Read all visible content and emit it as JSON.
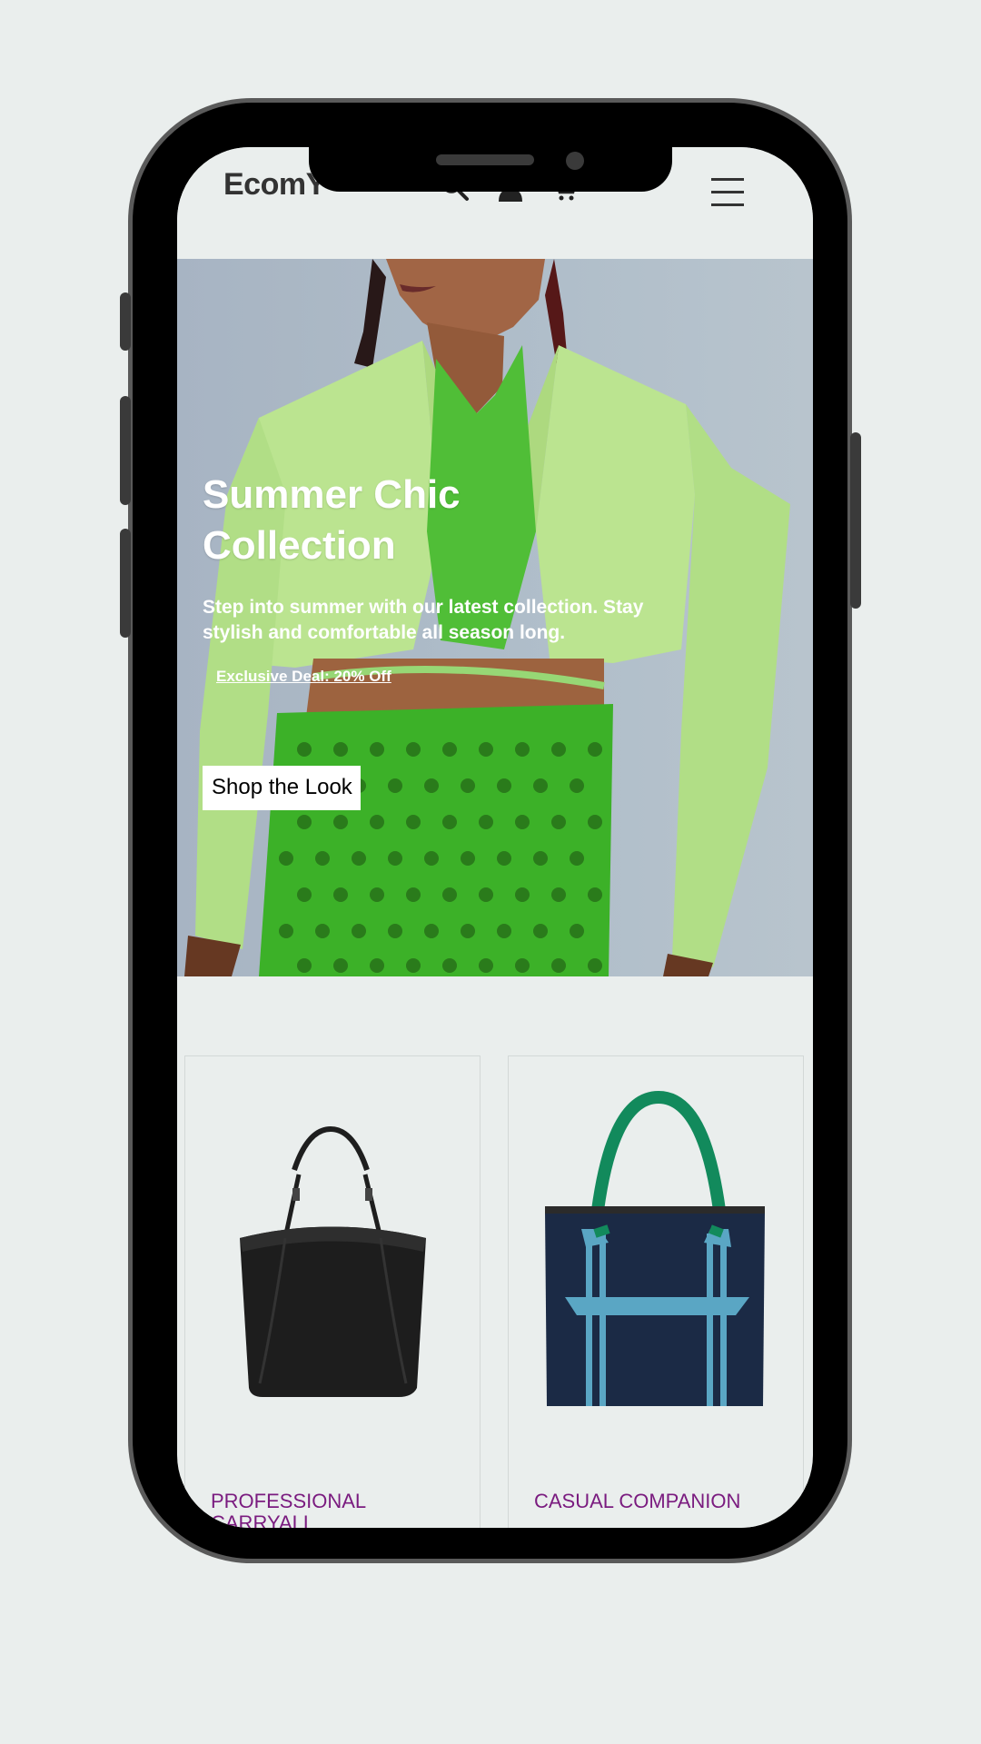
{
  "header": {
    "logo": "EcomY",
    "icons": [
      "search-icon",
      "user-icon",
      "cart-icon",
      "menu-icon"
    ]
  },
  "hero": {
    "title_line1": "Summer Chic",
    "title_line2": "Collection",
    "subtitle": "Step into summer with our latest collection. Stay stylish and comfortable all season long.",
    "deal_link": "Exclusive Deal: 20% Off",
    "cta_label": "Shop the Look"
  },
  "products": [
    {
      "title": "PROFESSIONAL CARRYALL"
    },
    {
      "title": "CASUAL COMPANION"
    }
  ],
  "colors": {
    "background": "#eaeeed",
    "product_title": "#7a1b7f",
    "phone_frame": "#000000"
  }
}
